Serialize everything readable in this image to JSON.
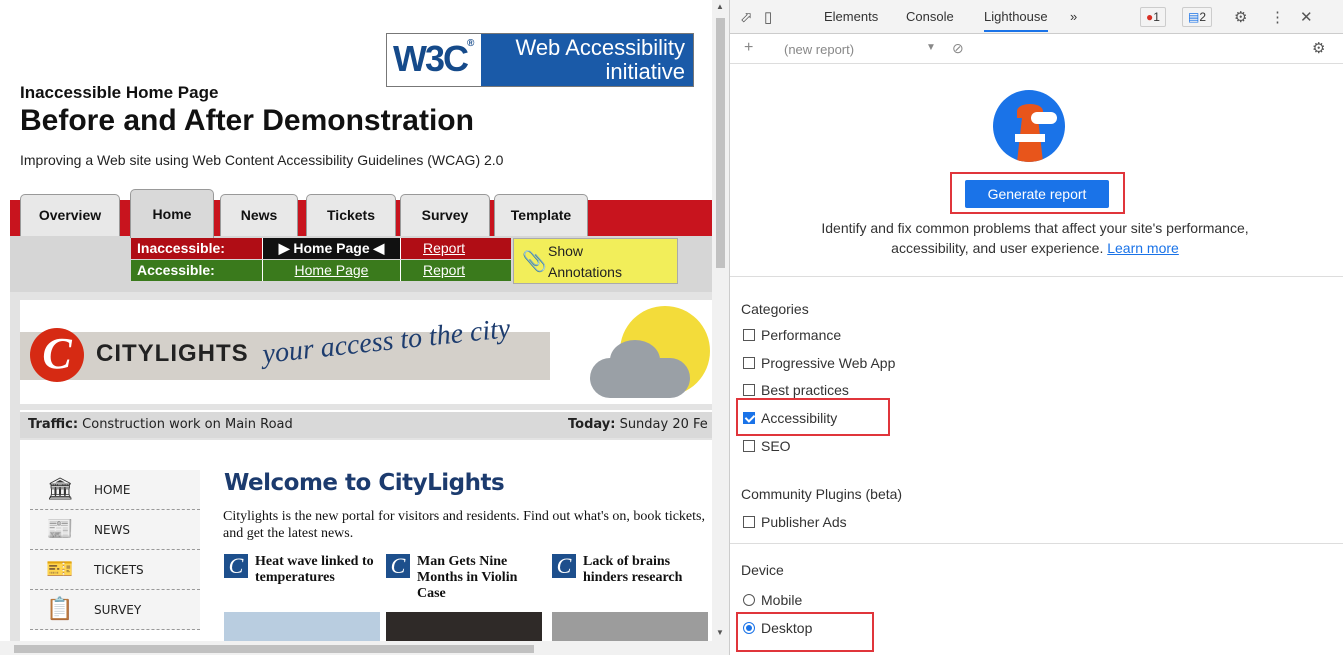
{
  "page": {
    "logo": {
      "w3c": "W3C",
      "reg": "®",
      "wai_line1": "Web Accessibility",
      "wai_line2": "initiative"
    },
    "kicker": "Inaccessible Home Page",
    "heading": "Before and After Demonstration",
    "subtitle": "Improving a Web site using Web Content Accessibility Guidelines (WCAG) 2.0",
    "tabs": [
      "Overview",
      "Home",
      "News",
      "Tickets",
      "Survey",
      "Template"
    ],
    "annot": {
      "inaccessible_label": "Inaccessible:",
      "accessible_label": "Accessible:",
      "inaccessible_page": "▶ Home Page ◀",
      "accessible_page": "Home Page",
      "report": "Report",
      "show_line1": "Show",
      "show_line2": "Annotations"
    },
    "banner": {
      "c": "C",
      "brand": "CITYLIGHTS",
      "slogan": "your access to the city"
    },
    "traffic": {
      "label": "Traffic:",
      "text": " Construction work on Main Road",
      "today_label": "Today:",
      "today_text": " Sunday 20 Fe"
    },
    "sidenav": [
      {
        "label": "HOME",
        "icon": "building-icon"
      },
      {
        "label": "NEWS",
        "icon": "newspaper-icon"
      },
      {
        "label": "TICKETS",
        "icon": "ticket-icon"
      },
      {
        "label": "SURVEY",
        "icon": "survey-icon"
      }
    ],
    "welcome": "Welcome to CityLights",
    "intro": "Citylights is the new portal for visitors and residents. Find out what's on, book tickets, and get the latest news.",
    "stories": [
      {
        "c": "C",
        "headline": "Heat wave linked to temperatures"
      },
      {
        "c": "C",
        "headline": "Man Gets Nine Months in Violin Case"
      },
      {
        "c": "C",
        "headline": "Lack of brains hinders research"
      }
    ]
  },
  "devtools": {
    "tabs": [
      "Elements",
      "Console",
      "Lighthouse"
    ],
    "more": "»",
    "errors": "1",
    "messages": "2",
    "new_report": "(new report)",
    "generate_label": "Generate report",
    "description": "Identify and fix common problems that affect your site's performance, accessibility, and user experience.",
    "learn_more": "Learn more",
    "categories_title": "Categories",
    "categories": [
      {
        "label": "Performance",
        "checked": false
      },
      {
        "label": "Progressive Web App",
        "checked": false
      },
      {
        "label": "Best practices",
        "checked": false
      },
      {
        "label": "Accessibility",
        "checked": true
      },
      {
        "label": "SEO",
        "checked": false
      }
    ],
    "plugins_title": "Community Plugins (beta)",
    "plugins": [
      {
        "label": "Publisher Ads",
        "checked": false
      }
    ],
    "device_title": "Device",
    "devices": [
      {
        "label": "Mobile",
        "selected": false
      },
      {
        "label": "Desktop",
        "selected": true
      }
    ],
    "highlight_color": "#e0353b",
    "accent_color": "#1a73e8"
  }
}
